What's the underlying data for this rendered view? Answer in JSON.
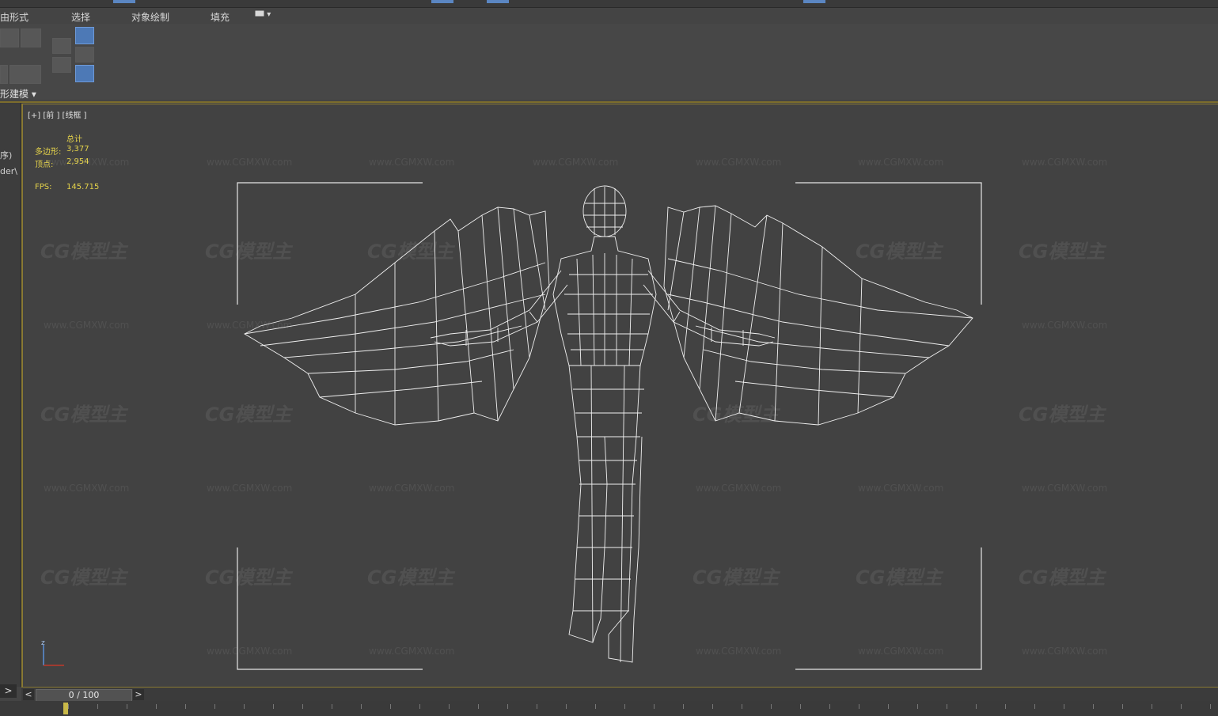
{
  "ribbon": {
    "tabs": [
      "由形式",
      "选择",
      "对象绘制",
      "填充"
    ],
    "dropdown_glyph": "▾",
    "group_label": "形建模"
  },
  "side_panel": {
    "stubs": [
      "序)",
      "der\\"
    ],
    "expand_arrow": ">"
  },
  "viewport": {
    "label_plus": "[+]",
    "label_view": "[前 ]",
    "label_mode": "[线框 ]",
    "stats": {
      "header": "总计",
      "polys_label": "多边形:",
      "polys_value": "3,377",
      "verts_label": "顶点:",
      "verts_value": "2,954",
      "fps_label": "FPS:",
      "fps_value": "145.715"
    },
    "gizmo_axis": "z",
    "watermark_logo": "CG模型主",
    "watermark_url": "www.CGMXW.com"
  },
  "timeline": {
    "prev": "<",
    "next": ">",
    "frame_text": "0 / 100"
  },
  "colors": {
    "stats_yellow": "#e5d34a",
    "viewport_border": "#8a7a34",
    "active_button": "#4d79b6"
  }
}
